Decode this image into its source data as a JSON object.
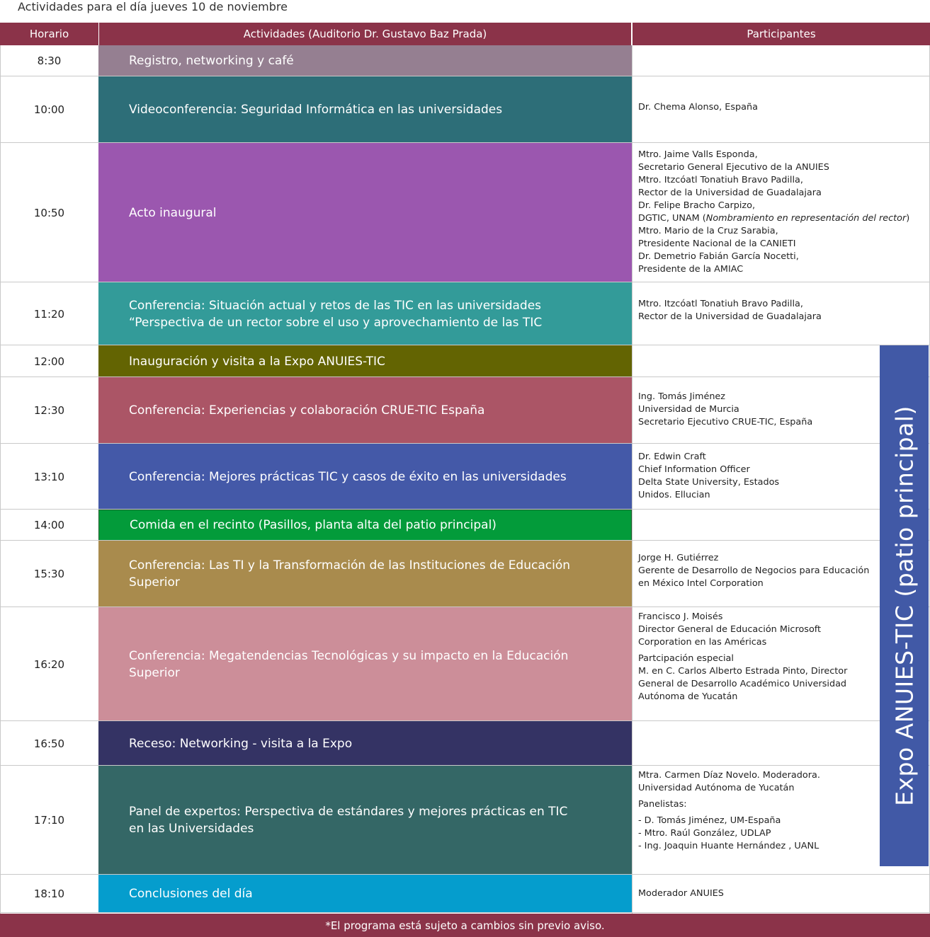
{
  "title": "Actividades para el día jueves 10 de noviembre",
  "header": {
    "horario": "Horario",
    "actividades": "Actividades (Auditorio Dr. Gustavo Baz Prada)",
    "participantes": "Participantes"
  },
  "rows": [
    {
      "time": "8:30",
      "activity": [
        "Registro, networking y café"
      ],
      "color": "#957f91",
      "participants": []
    },
    {
      "time": "10:00",
      "activity": [
        "Videoconferencia: Seguridad Informática en las universidades"
      ],
      "color": "#2d6e78",
      "participants": [
        "Dr. Chema Alonso, España"
      ]
    },
    {
      "time": "10:50",
      "activity": [
        "Acto inaugural"
      ],
      "color": "#9b57af",
      "participants": [
        "Mtro. Jaime Valls Esponda,",
        "Secretario General Ejecutivo de la ANUIES",
        "Mtro. Itzcóatl Tonatiuh Bravo Padilla,",
        "Rector de la Universidad de Guadalajara",
        "Dr. Felipe Bracho Carpizo,",
        "DGTIC, UNAM (",
        "Mtro. Mario de la Cruz Sarabia,",
        "Ptresidente Nacional de la CANIETI",
        "Dr. Demetrio Fabián García Nocetti,",
        "Presidente de la AMIAC"
      ],
      "italic_note": "Nombramiento en representación del rector",
      "italic_close": ")"
    },
    {
      "time": "11:20",
      "activity": [
        "Conferencia: Situación actual y retos de las TIC en las universidades",
        "“Perspectiva de un rector sobre el uso y aprovechamiento de las TIC"
      ],
      "color": "#339b99",
      "participants": [
        "Mtro. Itzcóatl Tonatiuh Bravo Padilla,",
        "Rector de la Universidad de Guadalajara"
      ]
    },
    {
      "time": "12:00",
      "activity": [
        "Inauguración y visita a la Expo ANUIES-TIC"
      ],
      "color": "#636402",
      "participants": []
    },
    {
      "time": "12:30",
      "activity": [
        "Conferencia: Experiencias y colaboración CRUE-TIC España"
      ],
      "color": "#ab5566",
      "participants": [
        "Ing. Tomás Jiménez",
        "Universidad de Murcia",
        "Secretario Ejecutivo CRUE-TIC, España"
      ]
    },
    {
      "time": "13:10",
      "activity": [
        "Conferencia: Mejores prácticas TIC y casos de éxito en las universidades"
      ],
      "color": "#4459a8",
      "participants": [
        "Dr. Edwin Craft",
        "Chief Information Officer",
        "Delta State University, Estados",
        "Unidos. Ellucian"
      ]
    },
    {
      "time": "14:00",
      "activity": [
        "Comida en el recinto (Pasillos, planta alta del patio principal)"
      ],
      "color": "#039b3a",
      "participants": []
    },
    {
      "time": "15:30",
      "activity": [
        "Conferencia: Las TI y la Transformación de las Instituciones de Educación",
        "Superior"
      ],
      "color": "#a98b4d",
      "participants": [
        "Jorge H. Gutiérrez",
        "Gerente de Desarrollo de Negocios para Educación",
        "en México Intel Corporation"
      ]
    },
    {
      "time": "16:20",
      "activity": [
        "Conferencia: Megatendencias Tecnológicas y su impacto en la Educación",
        "Superior"
      ],
      "color": "#cc8e99",
      "participants": [
        "Francisco J. Moisés",
        "Director General de Educación Microsoft",
        "Corporation en las Américas",
        "",
        "Partcipación especial",
        "M. en C. Carlos Alberto Estrada Pinto, Director",
        "General de Desarrollo Académico Universidad",
        "Autónoma de Yucatán"
      ]
    },
    {
      "time": "16:50",
      "activity": [
        "Receso: Networking - visita a la Expo"
      ],
      "color": "#343364",
      "participants": []
    },
    {
      "time": "17:10",
      "activity": [
        "Panel de expertos: Perspectiva de estándares y mejores prácticas en TIC",
        "en las Universidades"
      ],
      "color": "#346766",
      "participants": [
        "Mtra. Carmen Díaz Novelo. Moderadora.",
        "Universidad Autónoma de Yucatán",
        "",
        "Panelistas:",
        "",
        "- D. Tomás Jiménez, UM-España",
        "- Mtro. Raúl González, UDLAP",
        "- Ing. Joaquin Huante Hernández , UANL"
      ]
    },
    {
      "time": "18:10",
      "activity": [
        "Conclusiones del día"
      ],
      "color": "#059dcd",
      "participants": [
        "Moderador ANUIES"
      ]
    }
  ],
  "side_banner": "Expo ANUIES-TIC (patio principal)",
  "side_color": "#4159a6",
  "footer": "*El programa está sujeto a cambios sin previo aviso.",
  "header_color": "#8b3349"
}
